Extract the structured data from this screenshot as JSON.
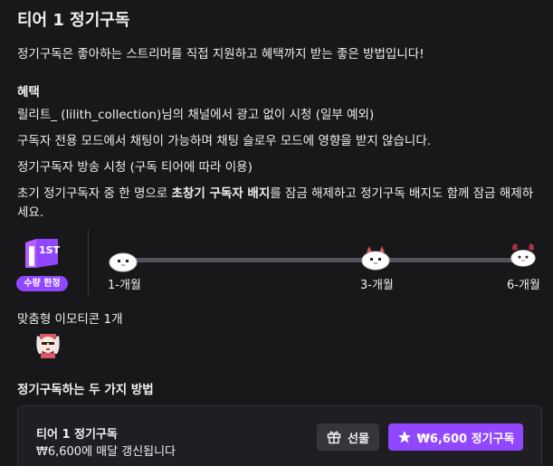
{
  "header": {
    "title": "티어 1 정기구독",
    "description": "정기구독은 좋아하는 스트리머를 직접 지원하고 혜택까지 받는 좋은 방법입니다!"
  },
  "benefits": {
    "heading": "혜택",
    "item1": "릴리트_ (lilith_collection)님의 채널에서 광고 없이 시청 (일부 예외)",
    "item2": "구독자 전용 모드에서 채팅이 가능하며 채팅 슬로우 모드에 영향을 받지 않습니다.",
    "item3": "정기구독자 방송 시청 (구독 티어에 따라 이용)",
    "item4_before": "초기 정기구독자 중 한 명으로 ",
    "item4_bold": "초창기 구독자 배지",
    "item4_after": "를 잠금 해제하고 정기구독 배지도 함께 잠금 해제하세요."
  },
  "badges": {
    "tier_label": "1ST",
    "limited_pill": "수량 한정",
    "milestones": [
      "1-개월",
      "3-개월",
      "6-개월"
    ]
  },
  "emotes": {
    "heading": "맞춤형 이모티콘 1개"
  },
  "methods": {
    "heading": "정기구독하는 두 가지 방법",
    "card_title": "티어 1 정기구독",
    "card_sub": "₩6,600에 매달 갱신됩니다",
    "gift_label": "선물",
    "subscribe_label": "₩6,600 정기구독"
  },
  "icons": {
    "gift": "gift-icon",
    "star": "star-icon"
  },
  "colors": {
    "accent": "#9147ff",
    "background": "#18181b",
    "card": "#1f1f23"
  }
}
